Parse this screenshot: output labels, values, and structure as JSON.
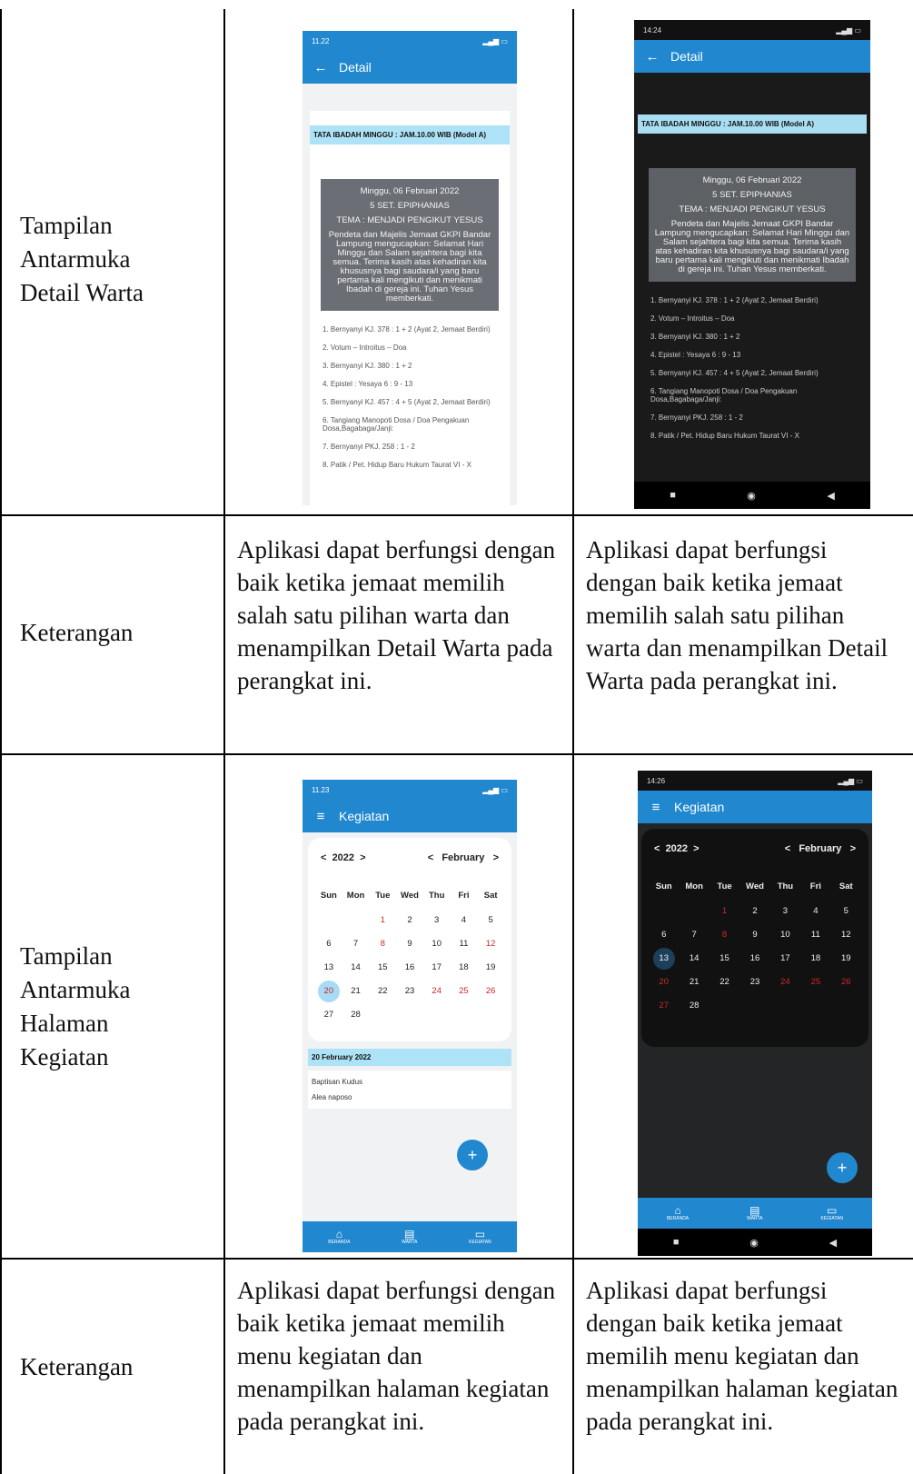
{
  "rows": [
    {
      "label": "Tampilan Antarmuka Detail Warta"
    },
    {
      "label": "Keterangan",
      "desc_left": "Aplikasi dapat berfungsi dengan baik ketika jemaat memilih salah satu pilihan warta dan menampilkan Detail Warta pada perangkat ini.",
      "desc_right": "Aplikasi dapat berfungsi dengan baik ketika jemaat memilih salah satu pilihan warta dan menampilkan Detail Warta pada perangkat ini."
    },
    {
      "label": "Tampilan Antarmuka Halaman Kegiatan"
    },
    {
      "label": "Keterangan",
      "desc_left": "Aplikasi dapat berfungsi dengan baik ketika jemaat memilih menu kegiatan dan menampilkan halaman kegiatan pada perangkat ini.",
      "desc_right": "Aplikasi dapat berfungsi dengan baik ketika jemaat memilih menu kegiatan dan menampilkan halaman kegiatan pada perangkat ini."
    }
  ],
  "detail": {
    "status_left_light": "11.22",
    "status_left_dark": "14:24",
    "title": "Detail",
    "tata": "TATA IBADAH MINGGU : JAM.10.00 WIB (Model A)",
    "date": "Minggu, 06 Februari 2022",
    "set": "5 SET. EPIPHANIAS",
    "tema": "TEMA : MENJADI PENGIKUT YESUS",
    "greeting": "Pendeta dan Majelis Jemaat GKPI Bandar Lampung mengucapkan: Selamat Hari Minggu dan Salam sejahtera bagi kita semua. Terima kasih atas kehadiran kita khususnya bagi saudara/i yang baru pertama kali mengikuti dan menikmati Ibadah di gereja ini. Tuhan Yesus memberkati.",
    "items": [
      "1. Bernyanyi KJ. 378 : 1 + 2 (Ayat 2, Jemaat Berdiri)",
      "2. Votum – Introitus – Doa",
      "3. Bernyanyi KJ. 380 : 1 + 2",
      "4. Epistel : Yesaya 6 : 9 - 13",
      "5. Bernyanyi KJ. 457 : 4 + 5 (Ayat 2, Jemaat Berdiri)",
      "6. Tangiang Manopoti Dosa / Doa Pengakuan Dosa,Bagabaga/Janji:",
      "7. Bernyanyi PKJ. 258 : 1 - 2",
      "8. Patik / Pet. Hidup Baru Hukum Taurat VI - X"
    ]
  },
  "kegiatan": {
    "status_left_light": "11.23",
    "status_left_dark": "14:26",
    "title": "Kegiatan",
    "year": "2022",
    "month": "February",
    "weekdays": [
      "Sun",
      "Mon",
      "Tue",
      "Wed",
      "Thu",
      "Fri",
      "Sat"
    ],
    "selected_light": "20",
    "selected_dark": "13",
    "event_date": "20 February 2022",
    "events": [
      "Baptisan Kudus",
      "Alea naposo"
    ],
    "nav": [
      "BERANDA",
      "WARTA",
      "KEGIATAN"
    ],
    "fab": "+"
  }
}
